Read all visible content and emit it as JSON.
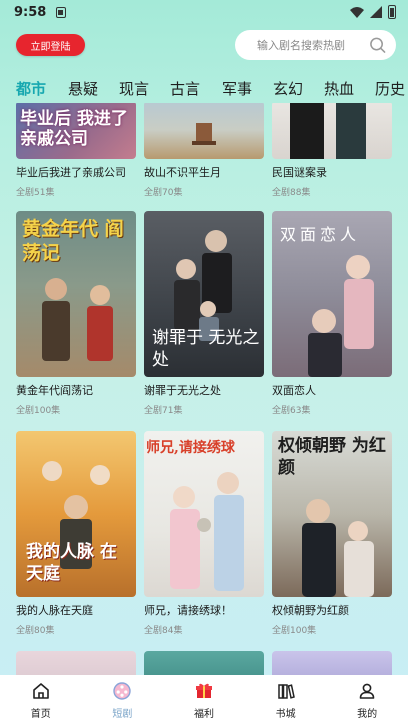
{
  "status_bar": {
    "time": "9:58"
  },
  "header": {
    "login_label": "立即登陆",
    "search_placeholder": "输入剧名搜索热剧"
  },
  "tabs": [
    {
      "label": "都市",
      "active": true
    },
    {
      "label": "悬疑"
    },
    {
      "label": "现言"
    },
    {
      "label": "古言"
    },
    {
      "label": "军事"
    },
    {
      "label": "玄幻"
    },
    {
      "label": "热血"
    },
    {
      "label": "历史"
    }
  ],
  "cards": [
    {
      "title": "毕业后我进了亲戚公司",
      "episodes": "全剧51集",
      "poster_text": "毕业后 我进了亲戚公司"
    },
    {
      "title": "故山不识平生月",
      "episodes": "全剧70集"
    },
    {
      "title": "民国谜案录",
      "episodes": "全剧88集"
    },
    {
      "title": "黄金年代阎荡记",
      "episodes": "全剧100集",
      "poster_text": "黄金年代 阎荡记"
    },
    {
      "title": "谢罪于无光之处",
      "episodes": "全剧71集",
      "poster_text": "谢罪于 无光之处"
    },
    {
      "title": "双面恋人",
      "episodes": "全剧63集",
      "poster_text": "双面恋人"
    },
    {
      "title": "我的人脉在天庭",
      "episodes": "全剧80集",
      "poster_text": "我的人脉 在天庭"
    },
    {
      "title": "师兄，请接绣球！",
      "episodes": "全剧84集",
      "poster_text": "师兄,请接绣球"
    },
    {
      "title": "权倾朝野为红颜",
      "episodes": "全剧100集",
      "poster_text": "权倾朝野 为红颜"
    }
  ],
  "bottom_nav": [
    {
      "label": "首页",
      "icon": "home-icon"
    },
    {
      "label": "短剧",
      "icon": "film-reel-icon",
      "active": true
    },
    {
      "label": "福利",
      "icon": "gift-icon"
    },
    {
      "label": "书城",
      "icon": "books-icon"
    },
    {
      "label": "我的",
      "icon": "profile-icon"
    }
  ]
}
